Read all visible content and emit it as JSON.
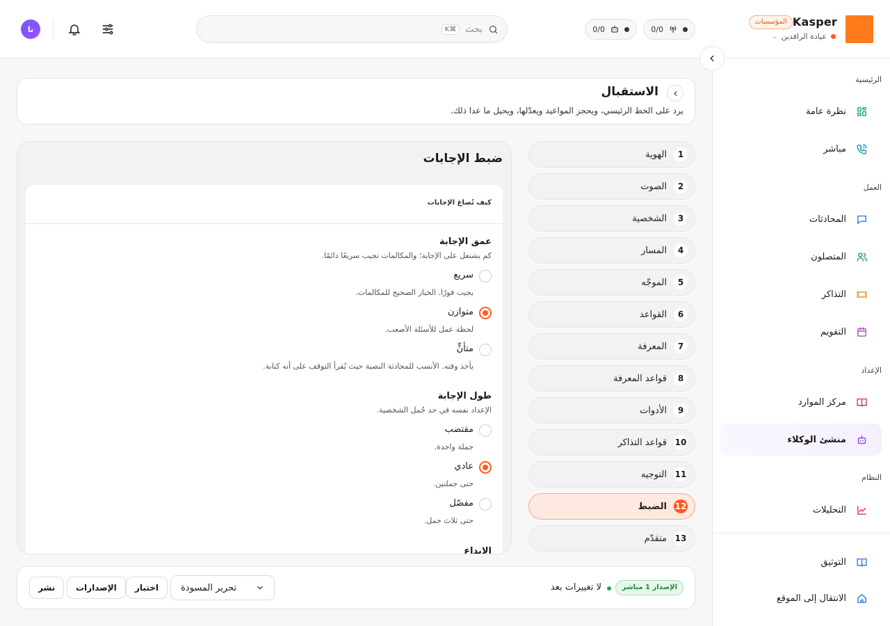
{
  "brand": {
    "name": "Kasper",
    "badge": "المؤسسات",
    "org": "عيادة الرافدين",
    "accent": "#ff7a1a"
  },
  "topbar": {
    "counter_calls": "0/0",
    "counter_bots": "0/0",
    "search_placeholder": "بحث",
    "search_shortcut": "⌘K",
    "avatar_initials": "نا"
  },
  "sidebar": {
    "sections": [
      {
        "title": "الرئيسية",
        "items": [
          {
            "label": "نظرة عامة",
            "icon": "grid-icon"
          },
          {
            "label": "مباشر",
            "icon": "phone-icon"
          }
        ]
      },
      {
        "title": "العمل",
        "items": [
          {
            "label": "المحادثات",
            "icon": "chat-icon"
          },
          {
            "label": "المتصلون",
            "icon": "users-icon"
          },
          {
            "label": "التذاكر",
            "icon": "ticket-icon"
          },
          {
            "label": "التقويم",
            "icon": "calendar-icon"
          }
        ]
      },
      {
        "title": "الإعداد",
        "items": [
          {
            "label": "مركز الموارد",
            "icon": "book-icon"
          },
          {
            "label": "منشئ الوكلاء",
            "icon": "bot-icon",
            "active": true
          }
        ]
      },
      {
        "title": "النظام",
        "items": [
          {
            "label": "التحليلات",
            "icon": "chart-icon"
          }
        ]
      }
    ],
    "footer": [
      {
        "label": "التوثيق",
        "icon": "book-icon"
      },
      {
        "label": "الانتقال إلى الموقع",
        "icon": "home-icon"
      }
    ]
  },
  "header": {
    "title": "الاستقبال",
    "description": "يرد على الخط الرئيسي، ويحجز المواعيد ويعدّلها، ويحيل ما عدا ذلك."
  },
  "steps": [
    {
      "num": "1",
      "label": "الهوية"
    },
    {
      "num": "2",
      "label": "الصوت"
    },
    {
      "num": "3",
      "label": "الشخصية"
    },
    {
      "num": "4",
      "label": "المسار"
    },
    {
      "num": "5",
      "label": "الموجّه"
    },
    {
      "num": "6",
      "label": "القواعد"
    },
    {
      "num": "7",
      "label": "المعرفة"
    },
    {
      "num": "8",
      "label": "قواعد المعرفة"
    },
    {
      "num": "9",
      "label": "الأدوات"
    },
    {
      "num": "10",
      "label": "قواعد التذاكر"
    },
    {
      "num": "11",
      "label": "التوجيه"
    },
    {
      "num": "12",
      "label": "الضبط",
      "active": true
    },
    {
      "num": "13",
      "label": "متقدّم"
    }
  ],
  "panel": {
    "title": "ضبط الإجابات",
    "card_heading": "كيف تُصاغ الإجابات",
    "depth": {
      "title": "عمق الإجابة",
      "description": "كم يشتغل على الإجابة؛ والمكالمات تجيب سريعًا دائمًا.",
      "options": [
        {
          "label": "سريع",
          "description": "يجيب فورًا. الخيار الصحيح للمكالمات.",
          "checked": false
        },
        {
          "label": "متوازن",
          "description": "لحظة عمل للأسئلة الأصعب.",
          "checked": true
        },
        {
          "label": "متأنٍّ",
          "description": "يأخذ وقته. الأنسب للمحادثة النصية حيث يُقرأ التوقف على أنه كتابة.",
          "checked": false
        }
      ]
    },
    "length": {
      "title": "طول الإجابة",
      "description": "الإعداد نفسه في حد جُمل الشخصية.",
      "options": [
        {
          "label": "مقتضب",
          "description": "جملة واحدة.",
          "checked": false
        },
        {
          "label": "عادي",
          "description": "حتى جملتين.",
          "checked": true
        },
        {
          "label": "مفصّل",
          "description": "حتى ثلاث جمل.",
          "checked": false
        }
      ]
    },
    "next_group_title": "الإبداع"
  },
  "bottom": {
    "version_badge": "الإصدار 1 مباشر",
    "status": "لا تغييرات بعد",
    "draft_select": "تحرير المسودة",
    "test_label": "اختبار",
    "versions_label": "الإصدارات",
    "publish_label": "نشر"
  }
}
